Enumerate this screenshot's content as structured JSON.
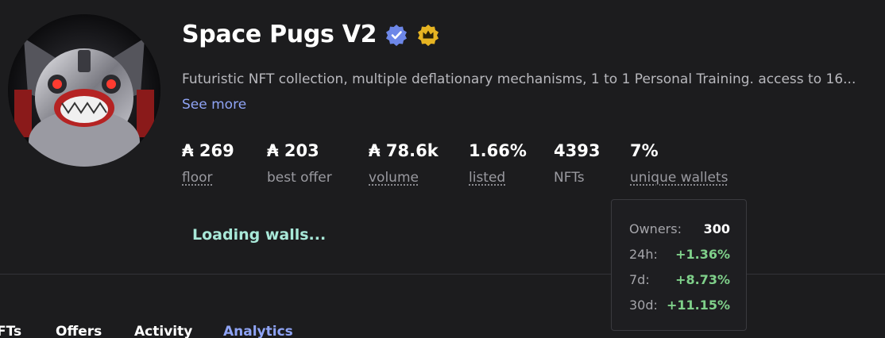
{
  "collection": {
    "name": "Space Pugs V2",
    "description": "Futuristic NFT collection, multiple deflationary mechanisms, 1 to 1 Personal Training. access to 16...",
    "see_more": "See more",
    "verified_icon": "verified-badge-icon",
    "crown_icon": "crown-badge-icon"
  },
  "stats": [
    {
      "value": "₳ 269",
      "label": "floor"
    },
    {
      "value": "₳ 203",
      "label": "best offer"
    },
    {
      "value": "₳ 78.6k",
      "label": "volume"
    },
    {
      "value": "1.66%",
      "label": "listed"
    },
    {
      "value": "4393",
      "label": "NFTs"
    },
    {
      "value": "7%",
      "label": "unique wallets"
    }
  ],
  "loading_text": "Loading walls...",
  "wallets_popover": {
    "rows": [
      {
        "label": "Owners:",
        "value": "300"
      },
      {
        "label": "24h:",
        "value": "+1.36%"
      },
      {
        "label": "7d:",
        "value": "+8.73%"
      },
      {
        "label": "30d:",
        "value": "+11.15%"
      }
    ]
  },
  "tabs": [
    {
      "label": "FTs"
    },
    {
      "label": "Offers"
    },
    {
      "label": "Activity"
    },
    {
      "label": "Analytics"
    }
  ],
  "colors": {
    "background": "#1c1c1e",
    "accent": "#8fa4f5",
    "positive": "#7fd08a",
    "loading": "#a8e8d8"
  }
}
